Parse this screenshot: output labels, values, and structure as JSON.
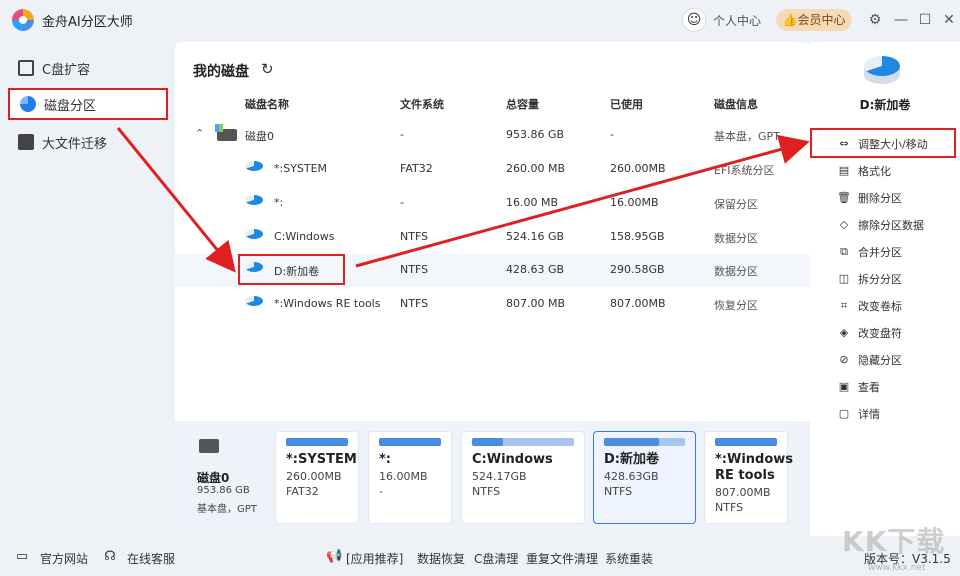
{
  "app": {
    "title": "金舟AI分区大师",
    "user_center": "个人中心",
    "vip_center": "会员中心",
    "version": "版本号：V3.1.5"
  },
  "sidebar": {
    "items": [
      {
        "label": "C盘扩容",
        "icon": "expand-icon"
      },
      {
        "label": "磁盘分区",
        "icon": "partition-icon"
      },
      {
        "label": "大文件迁移",
        "icon": "migrate-icon"
      }
    ]
  },
  "main": {
    "title": "我的磁盘",
    "columns": [
      "磁盘名称",
      "文件系统",
      "总容量",
      "已使用",
      "磁盘信息"
    ],
    "disk": {
      "name": "磁盘0",
      "fs": "-",
      "total": "953.86 GB",
      "used": "-",
      "info": "基本盘，GPT"
    },
    "partitions": [
      {
        "name": "*:SYSTEM",
        "fs": "FAT32",
        "total": "260.00 MB",
        "used": "260.00MB",
        "info": "EFI系统分区"
      },
      {
        "name": "*:",
        "fs": "-",
        "total": "16.00 MB",
        "used": "16.00MB",
        "info": "保留分区"
      },
      {
        "name": "C:Windows",
        "fs": "NTFS",
        "total": "524.16 GB",
        "used": "158.95GB",
        "info": "数据分区"
      },
      {
        "name": "D:新加卷",
        "fs": "NTFS",
        "total": "428.63 GB",
        "used": "290.58GB",
        "info": "数据分区"
      },
      {
        "name": "*:Windows RE tools",
        "fs": "NTFS",
        "total": "807.00 MB",
        "used": "807.00MB",
        "info": "恢复分区"
      }
    ]
  },
  "map": {
    "disk": {
      "name": "磁盘0",
      "size": "953.86 GB",
      "type": "基本盘，GPT"
    },
    "cards": [
      {
        "label": "*:SYSTEM",
        "size": "260.00MB",
        "fs": "FAT32",
        "usage": 1.0
      },
      {
        "label": "*:",
        "size": "16.00MB",
        "fs": "-",
        "usage": 1.0
      },
      {
        "label": "C:Windows",
        "size": "524.17GB",
        "fs": "NTFS",
        "usage": 0.3
      },
      {
        "label": "D:新加卷",
        "size": "428.63GB",
        "fs": "NTFS",
        "usage": 0.68
      },
      {
        "label": "*:Windows RE tools",
        "size": "807.00MB",
        "fs": "NTFS",
        "usage": 1.0
      }
    ]
  },
  "right_panel": {
    "selected": "D:新加卷",
    "actions": [
      {
        "label": "调整大小/移动",
        "icon": "resize-icon"
      },
      {
        "label": "格式化",
        "icon": "format-icon"
      },
      {
        "label": "删除分区",
        "icon": "delete-icon"
      },
      {
        "label": "擦除分区数据",
        "icon": "eraser-icon"
      },
      {
        "label": "合并分区",
        "icon": "merge-icon"
      },
      {
        "label": "拆分分区",
        "icon": "split-icon"
      },
      {
        "label": "改变卷标",
        "icon": "tag-icon"
      },
      {
        "label": "改变盘符",
        "icon": "drive-letter-icon"
      },
      {
        "label": "隐藏分区",
        "icon": "hide-icon"
      },
      {
        "label": "查看",
        "icon": "view-icon"
      },
      {
        "label": "详情",
        "icon": "details-icon"
      }
    ]
  },
  "footer": {
    "website": "官方网站",
    "support": "在线客服",
    "recommend": "[应用推荐]",
    "links": [
      "数据恢复",
      "C盘清理",
      "重复文件清理",
      "系统重装"
    ]
  },
  "watermark": {
    "text": "KK下载",
    "url": "www.kkx.net"
  },
  "colors": {
    "accent": "#1e7fe6",
    "annotation": "#e02020",
    "vip": "#f6d9b5"
  }
}
